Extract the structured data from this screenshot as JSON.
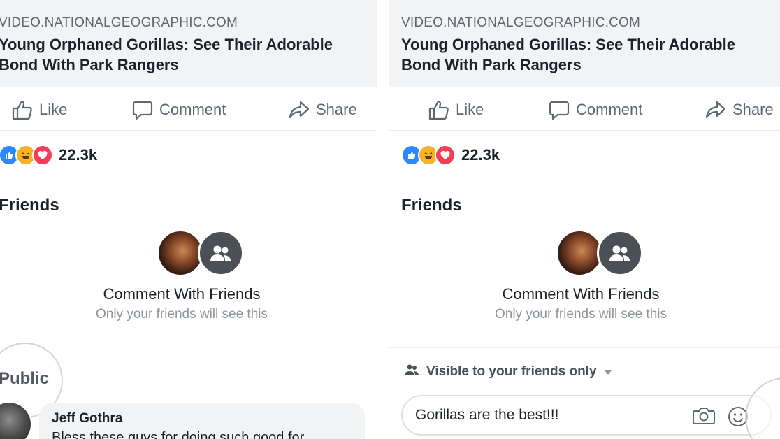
{
  "post": {
    "link_domain": "VIDEO.NATIONALGEOGRAPHIC.COM",
    "link_title": "Young Orphaned Gorillas: See Their Adorable Bond With Park Rangers"
  },
  "actions": {
    "like": "Like",
    "comment": "Comment",
    "share": "Share"
  },
  "reactions": {
    "icons": [
      "like-icon",
      "haha-icon",
      "love-icon"
    ],
    "count": "22.3k",
    "colors": {
      "like": "#2d88ff",
      "haha": "#f7b125",
      "love": "#f33e58"
    }
  },
  "friends_section": {
    "title": "Friends",
    "cta_title": "Comment With Friends",
    "cta_subtitle": "Only your friends will see this"
  },
  "left_panel": {
    "public_title": "Public",
    "comment": {
      "author": "Jeff Gothra",
      "text": "Bless these guys for doing such good for"
    }
  },
  "right_panel": {
    "audience_label": "Visible to your friends only",
    "composer_value": "Gorillas are the best!!!"
  },
  "colors": {
    "preview_bg": "#f2f3f5",
    "secondary_text": "#606770",
    "muted_text": "#90949c",
    "group_avatar_bg": "#4b4f56"
  }
}
